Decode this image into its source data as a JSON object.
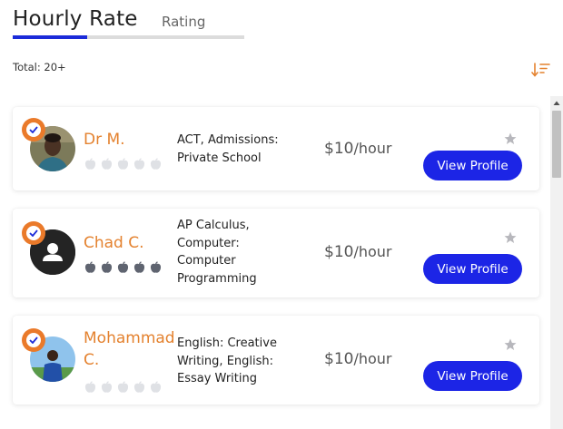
{
  "tabs": {
    "active": "Hourly Rate",
    "other": "Rating"
  },
  "total_label": "Total: 20+",
  "colors": {
    "accent": "#e4822f",
    "primary_button": "#1c25e6",
    "tab_underline": "#1b2bd9"
  },
  "tutors": [
    {
      "name": "Dr M.",
      "subjects": "ACT, Admissions: Private School",
      "rate": "$10",
      "rate_unit": "/hour",
      "button": "View Profile",
      "rating_filled": 0,
      "rating_max": 5,
      "avatar": "photo"
    },
    {
      "name": "Chad C.",
      "subjects": "AP Calculus, Computer: Computer Programming",
      "rate": "$10",
      "rate_unit": "/hour",
      "button": "View Profile",
      "rating_filled": 5,
      "rating_max": 5,
      "avatar": "default-user-icon"
    },
    {
      "name": "Mohammad C.",
      "subjects": "English: Creative Writing, English: Essay Writing",
      "rate": "$10",
      "rate_unit": "/hour",
      "button": "View Profile",
      "rating_filled": 0,
      "rating_max": 5,
      "avatar": "photo"
    }
  ]
}
